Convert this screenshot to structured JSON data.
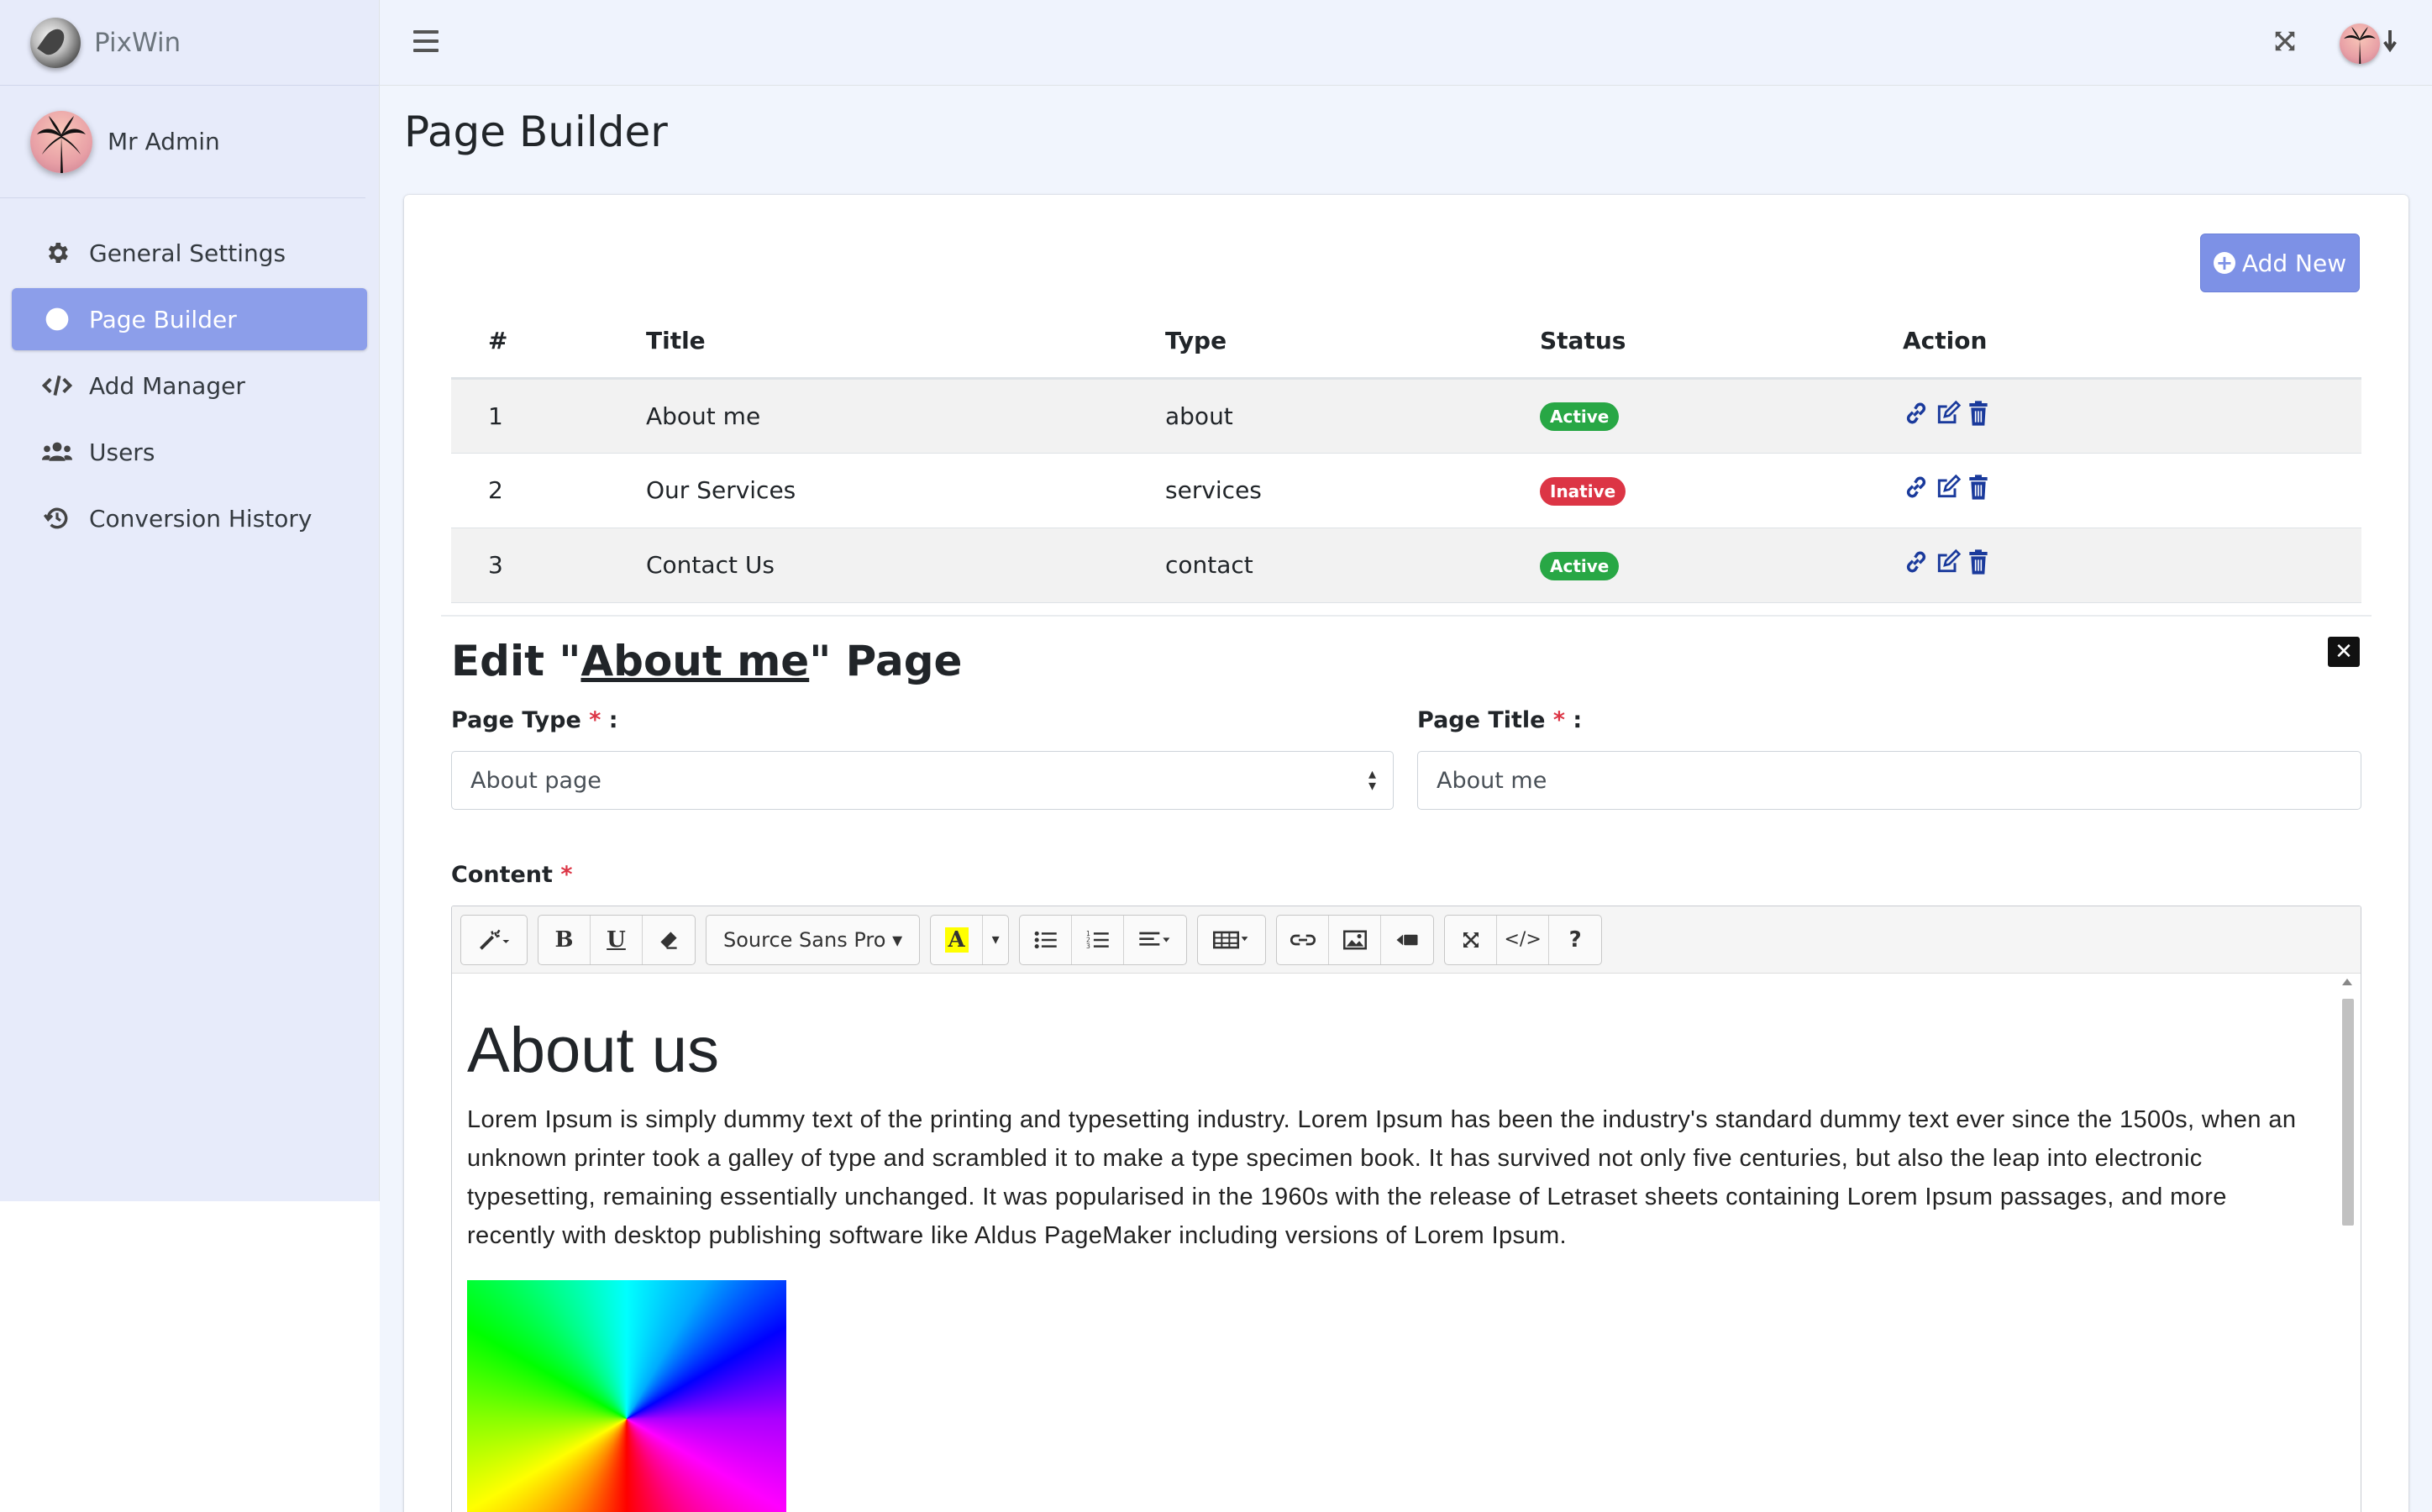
{
  "brand": {
    "name": "PixWin"
  },
  "user": {
    "name": "Mr Admin"
  },
  "sidebar": {
    "items": [
      {
        "label": "General Settings",
        "icon": "gear-icon"
      },
      {
        "label": "Page Builder",
        "icon": "circle-icon",
        "active": true
      },
      {
        "label": "Add Manager",
        "icon": "code-icon"
      },
      {
        "label": "Users",
        "icon": "users-icon"
      },
      {
        "label": "Conversion History",
        "icon": "history-icon"
      }
    ]
  },
  "header": {
    "title": "Page Builder"
  },
  "toolbar": {
    "add_label": "Add New"
  },
  "table": {
    "headers": [
      "#",
      "Title",
      "Type",
      "Status",
      "Action"
    ],
    "rows": [
      {
        "num": "1",
        "title": "About me",
        "type": "about",
        "status": "Active"
      },
      {
        "num": "2",
        "title": "Our Services",
        "type": "services",
        "status": "Inative"
      },
      {
        "num": "3",
        "title": "Contact Us",
        "type": "contact",
        "status": "Active"
      }
    ]
  },
  "edit": {
    "prefix": "Edit \"",
    "page_name": "About me",
    "suffix": "\" Page",
    "page_type_label": "Page Type",
    "page_type_value": "About page",
    "page_title_label": "Page Title",
    "page_title_value": "About me",
    "content_label": "Content",
    "colon": " :",
    "required_mark": "*"
  },
  "editor": {
    "font_name": "Source Sans Pro",
    "heading": "About us",
    "paragraph": "Lorem Ipsum is simply dummy text of the printing and typesetting industry. Lorem Ipsum has been the industry's standard dummy text ever since the 1500s, when an unknown printer took a galley of type and scrambled it to make a type specimen book. It has survived not only five centuries, but also the leap into electronic typesetting, remaining essentially unchanged. It was popularised in the 1960s with the release of Letraset sheets containing Lorem Ipsum passages, and more recently with desktop publishing software like Aldus PageMaker including versions of Lorem Ipsum.",
    "bold_label": "B",
    "underline_label": "U",
    "help_label": "?",
    "code_label": "</>",
    "highlight_label": "A"
  },
  "colors": {
    "accent": "#8c9eea",
    "active_badge": "#28a745",
    "inactive_badge": "#dc3545",
    "action_icon": "#1a3a9c"
  }
}
